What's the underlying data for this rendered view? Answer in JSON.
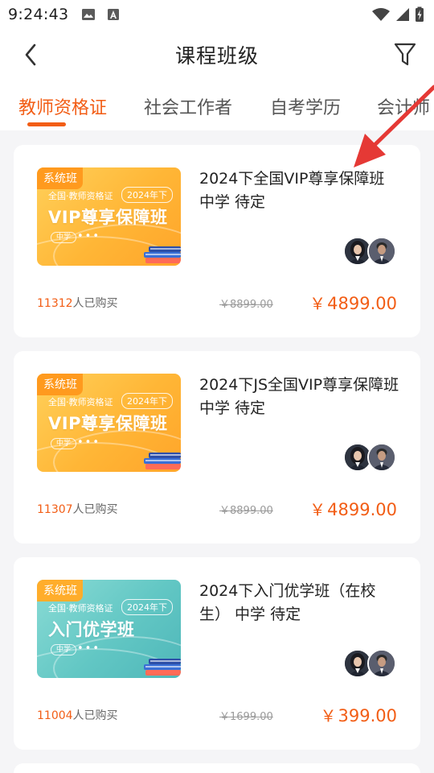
{
  "status_bar": {
    "time": "9:24:43",
    "icons": [
      "image-icon",
      "notification-a-icon",
      "wifi-icon",
      "signal-icon",
      "battery-charging-icon"
    ]
  },
  "header": {
    "title": "课程班级",
    "back_icon": "chevron-left-icon",
    "filter_icon": "filter-funnel-icon"
  },
  "tabs": [
    {
      "label": "教师资格证",
      "active": true
    },
    {
      "label": "社会工作者",
      "active": false
    },
    {
      "label": "自考学历",
      "active": false
    },
    {
      "label": "会计师",
      "active": false
    }
  ],
  "colors": {
    "accent": "#f25d15",
    "badge": "#ff9a1e",
    "annotation": "#e53935"
  },
  "courses": [
    {
      "thumb": {
        "theme": "orange",
        "badge": "系统班",
        "subtitle": "全国·教师资格证",
        "year": "2024年下",
        "main": "VIP尊享保障班",
        "tag": "中学"
      },
      "title": "2024下全国VIP尊享保障班 中学 待定",
      "buyers_count": "11312",
      "buyers_suffix": "人已购买",
      "original_price": "￥8899.00",
      "currency": "￥",
      "price": "4899.00"
    },
    {
      "thumb": {
        "theme": "orange",
        "badge": "系统班",
        "subtitle": "全国·教师资格证",
        "year": "2024年下",
        "main": "VIP尊享保障班",
        "tag": "中学"
      },
      "title": "2024下JS全国VIP尊享保障班 中学 待定",
      "buyers_count": "11307",
      "buyers_suffix": "人已购买",
      "original_price": "￥8899.00",
      "currency": "￥",
      "price": "4899.00"
    },
    {
      "thumb": {
        "theme": "teal",
        "badge": "系统班",
        "subtitle": "全国·教师资格证",
        "year": "2024年下",
        "main": "入门优学班",
        "tag": "中学"
      },
      "title": "2024下入门优学班（在校生） 中学 待定",
      "buyers_count": "11004",
      "buyers_suffix": "人已购买",
      "original_price": "￥1699.00",
      "currency": "￥",
      "price": "399.00"
    }
  ]
}
